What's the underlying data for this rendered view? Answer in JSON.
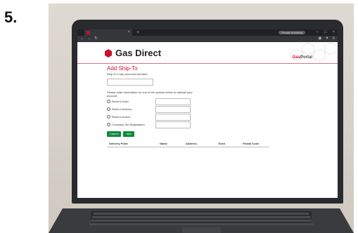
{
  "step_number": "5.",
  "browser": {
    "tab_title": "",
    "profile_label": "Private browsing",
    "url": "",
    "new_tab": "+",
    "close_tab": "×"
  },
  "site": {
    "brand": "Gas Direct",
    "portal_prefix": "Gas",
    "portal_suffix": "Portal",
    "brand_color": "#c8102e"
  },
  "form": {
    "title": "Add Ship-To",
    "ship_to_label": "Ship-To Code (Account Number)",
    "ship_to_value": "",
    "instructions": "Please enter information for one of the options below to validate your account:",
    "options": [
      {
        "label": "Recent Order"
      },
      {
        "label": "Recent Delivery"
      },
      {
        "label": "Recent Invoice"
      },
      {
        "label": "Company Tax Registration"
      }
    ],
    "cancel_label": "Cancel",
    "add_label": "Add",
    "button_color": "#0a8a3a"
  },
  "table": {
    "headers": [
      "Delivery Point",
      "Name",
      "Address",
      "Town",
      "Postal Code"
    ]
  }
}
